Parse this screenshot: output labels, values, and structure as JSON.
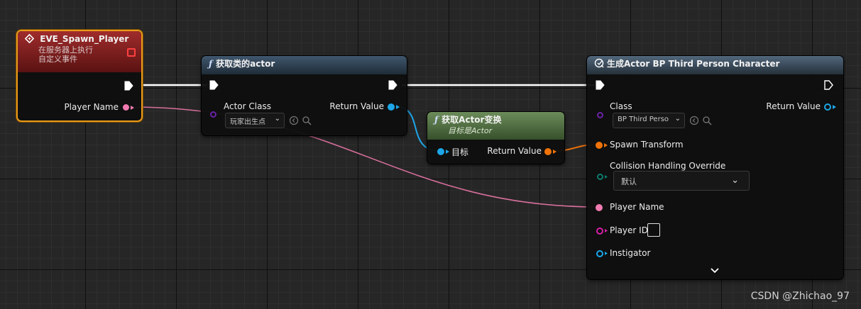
{
  "colors": {
    "exec": "#ffffff",
    "string_pin": "#f07ab0",
    "class_pin": "#6b22a8",
    "object_pin": "#1da6e8",
    "transform_pin": "#f0730a",
    "enum_pin": "#0d7a6c",
    "int_pin": "#d81ea8",
    "selection": "#e79a1a"
  },
  "event_node": {
    "title": "EVE_Spawn_Player",
    "subtitle1": "在服务器上执行",
    "subtitle2": "自定义事件",
    "output_pin": "Player Name"
  },
  "get_class_node": {
    "title": "获取类的actor",
    "input_label": "Actor Class",
    "input_value": "玩家出生点",
    "output_label": "Return Value"
  },
  "get_transform_node": {
    "title": "获取Actor变换",
    "subtitle": "目标是Actor",
    "input_label": "目标",
    "output_label": "Return Value"
  },
  "spawn_node": {
    "title": "生成Actor BP Third Person Character",
    "class_label": "Class",
    "class_value": "BP Third Perso",
    "return_label": "Return Value",
    "spawn_transform": "Spawn Transform",
    "collision_label": "Collision Handling Override",
    "collision_value": "默认",
    "player_name": "Player Name",
    "player_id": "Player ID",
    "instigator": "Instigator"
  },
  "watermark": "CSDN @Zhichao_97"
}
